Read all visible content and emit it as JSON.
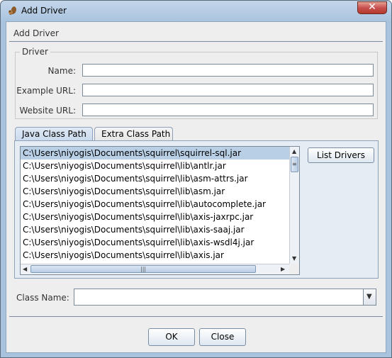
{
  "window": {
    "title": "Add Driver",
    "close_glyph": "✕",
    "icon": "squirrel-icon"
  },
  "header": {
    "label": "Add Driver"
  },
  "driver_group": {
    "title": "Driver",
    "name_label": "Name:",
    "name_value": "",
    "example_url_label": "Example URL:",
    "example_url_value": "",
    "website_url_label": "Website URL:",
    "website_url_value": ""
  },
  "tabs": [
    {
      "label": "Java Class Path",
      "active": true
    },
    {
      "label": "Extra Class Path",
      "active": false
    }
  ],
  "class_path_list": [
    "C:\\Users\\niyogis\\Documents\\squirrel\\squirrel-sql.jar",
    "C:\\Users\\niyogis\\Documents\\squirrel\\lib\\antlr.jar",
    "C:\\Users\\niyogis\\Documents\\squirrel\\lib\\asm-attrs.jar",
    "C:\\Users\\niyogis\\Documents\\squirrel\\lib\\asm.jar",
    "C:\\Users\\niyogis\\Documents\\squirrel\\lib\\autocomplete.jar",
    "C:\\Users\\niyogis\\Documents\\squirrel\\lib\\axis-jaxrpc.jar",
    "C:\\Users\\niyogis\\Documents\\squirrel\\lib\\axis-saaj.jar",
    "C:\\Users\\niyogis\\Documents\\squirrel\\lib\\axis-wsdl4j.jar",
    "C:\\Users\\niyogis\\Documents\\squirrel\\lib\\axis.jar"
  ],
  "selected_index": 0,
  "list_drivers_label": "List Drivers",
  "class_name": {
    "label": "Class Name:",
    "value": ""
  },
  "buttons": {
    "ok_label": "OK",
    "close_label": "Close"
  },
  "colors": {
    "selection": "#b8cfe5",
    "title_bar": "#a9c3de",
    "close_button": "#c75050"
  }
}
